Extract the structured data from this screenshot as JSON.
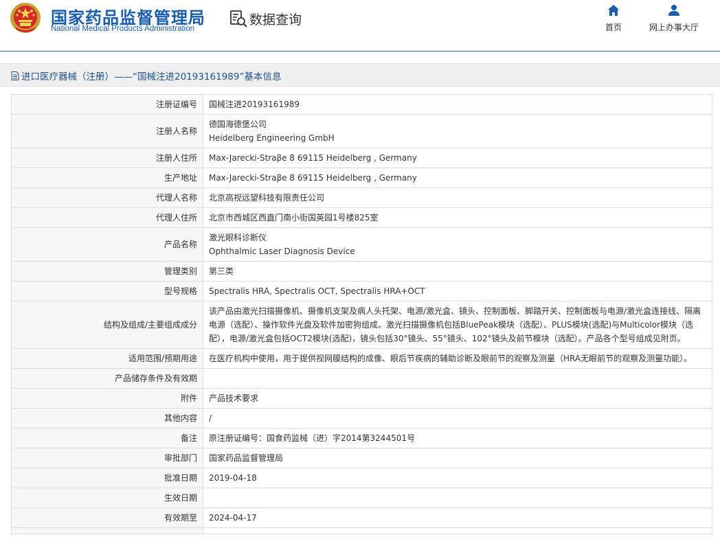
{
  "header": {
    "site_title_cn": "国家药品监督管理局",
    "site_title_en": "National Medical Products Administration",
    "query_label": "数据查询",
    "nav": [
      {
        "label": "首页",
        "icon": "home-icon"
      },
      {
        "label": "网上办事大厅",
        "icon": "user-icon"
      }
    ]
  },
  "breadcrumb": {
    "icon": "document-icon",
    "text": "进口医疗器械（注册）——“国械注进20193161989”基本信息"
  },
  "colors": {
    "brand_blue": "#1a5cae",
    "header_line": "#2b7ab0",
    "crumb_text": "#1c4f8c",
    "label_bg": "#f7f7f7"
  },
  "rows": [
    {
      "label": "注册证编号",
      "value": "国械注进20193161989"
    },
    {
      "label": "注册人名称",
      "value": "德国海德堡公司",
      "value2": "Heidelberg Engineering GmbH"
    },
    {
      "label": "注册人住所",
      "value": "Max-Jarecki-Straβe 8 69115 Heidelberg , Germany"
    },
    {
      "label": "生产地址",
      "value": "Max-Jarecki-Straβe 8 69115 Heidelberg , Germany"
    },
    {
      "label": "代理人名称",
      "value": "北京高视远望科技有限责任公司"
    },
    {
      "label": "代理人住所",
      "value": "北京市西城区西直门南小街国英园1号楼825室"
    },
    {
      "label": "产品名称",
      "value": "激光眼科诊断仪",
      "value2": "Ophthalmic Laser Diagnosis Device"
    },
    {
      "label": "管理类别",
      "value": "第三类"
    },
    {
      "label": "型号规格",
      "value": "Spectralis HRA, Spectralis OCT, Spectralis HRA+OCT"
    },
    {
      "label": "结构及组成/主要组成成分",
      "value": "该产品由激光扫描摄像机、摄像机支架及病人头托架、电源/激光盒、镜头、控制面板、脚踏开关、控制面板与电源/激光盒连接线、隔离电源（选配）、操作软件光盘及软件加密狗组成。激光扫描摄像机包括BluePeak模块（选配）、PLUS模块(选配)与Multicolor模块（选配），电源/激光盒包括OCT2模块(选配)，镜头包括30°镜头、55°镜头、102°镜头及前节模块（选配）。产品各个型号组成见附页。"
    },
    {
      "label": "适用范围/预期用途",
      "value": "在医疗机构中使用，用于提供视网膜结构的成像、眼后节疾病的辅助诊断及眼前节的观察及测量（HRA无眼前节的观察及测量功能）。"
    },
    {
      "label": "产品储存条件及有效期",
      "value": ""
    },
    {
      "label": "附件",
      "value": "产品技术要求"
    },
    {
      "label": "其他内容",
      "value": "/"
    },
    {
      "label": "备注",
      "value": "原注册证编号：国食药监械（进）字2014第3244501号"
    },
    {
      "label": "审批部门",
      "value": "国家药品监督管理局"
    },
    {
      "label": "批准日期",
      "value": "2019-04-18"
    },
    {
      "label": "生效日期",
      "value": ""
    },
    {
      "label": "有效期至",
      "value": "2024-04-17"
    },
    {
      "label": "",
      "value": ""
    }
  ]
}
